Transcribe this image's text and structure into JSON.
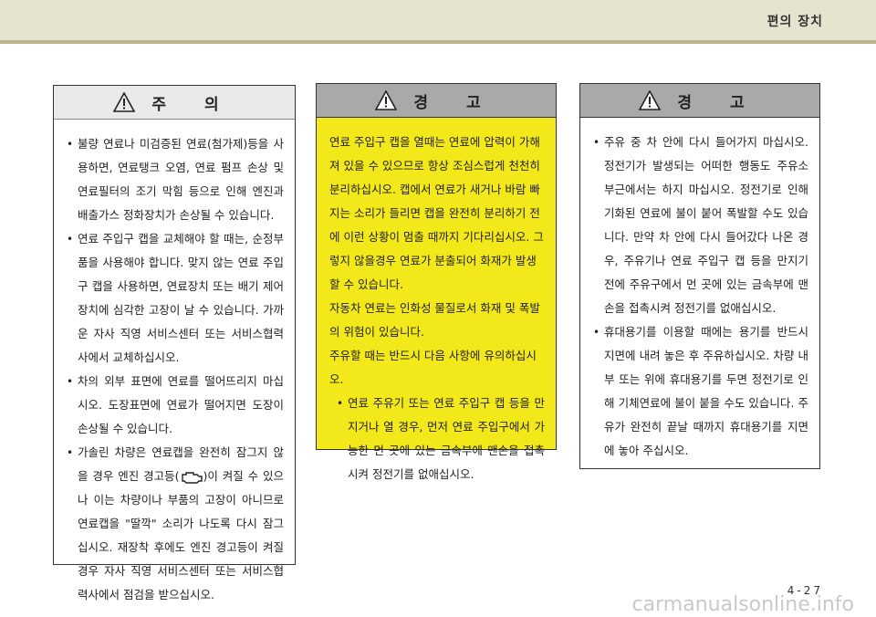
{
  "header": {
    "section_title": "편의 장치"
  },
  "caution": {
    "title": "주  의",
    "items": [
      "불량 연료나 미검증된 연료(첨가제)등을 사용하면, 연료탱크 오염, 연료 펌프 손상 및 연료필터의 조기 막힘 등으로 인해 엔진과 배출가스 정화장치가 손상될 수 있습니다.",
      "연료 주입구 캡을 교체해야 할 때는, 순정부품을 사용해야 합니다. 맞지 않는 연료 주입구 캡을 사용하면, 연료장치 또는 배기 제어장치에 심각한 고장이 날 수 있습니다. 가까운 자사 직영 서비스센터 또는 서비스협력사에서 교체하십시오.",
      "차의 외부 표면에 연료를 떨어뜨리지 마십시오. 도장표면에 연료가 떨어지면 도장이 손상될 수 있습니다.",
      {
        "before": "가솔린 차량은 연료캡을 완전히 잠그지 않을 경우 엔진 경고등(",
        "icon": "engine-check-icon",
        "after": ")이 켜질 수 있으나 이는 차량이나 부품의 고장이 아니므로 연료캡을 \"딸깍\" 소리가 나도록 다시 잠그십시오. 재장착 후에도 엔진 경고등이 켜질 경우 자사 직영 서비스센터 또는 서비스협력사에서 점검을 받으십시오."
      }
    ]
  },
  "warning1": {
    "title": "경  고",
    "paragraphs": [
      "연료 주입구 캡을 열때는 연료에 압력이 가해져 있을 수 있으므로 항상 조심스럽게 천천히 분리하십시오. 캡에서 연료가 새거나 바람 빠지는 소리가 들리면 캡을 완전히 분리하기 전에 이런 상황이 멈출 때까지 기다리십시오. 그렇지 않을경우 연료가 분출되어 화재가 발생할 수 있습니다.",
      "자동차 연료는 인화성 물질로서 화재 및 폭발의 위험이 있습니다.",
      "주유할 때는 반드시 다음 사항에 유의하십시오."
    ],
    "items": [
      "연료 주유기 또는 연료 주입구 캡 등을 만지거나 열 경우, 먼저 연료 주입구에서 가능한 먼 곳에 있는 금속부에 맨손을 접촉시켜 정전기를 없애십시오."
    ]
  },
  "warning2": {
    "title": "경  고",
    "items": [
      "주유 중 차 안에 다시 들어가지 마십시오. 정전기가 발생되는 어떠한 행동도 주유소 부근에서는 하지 마십시오. 정전기로 인해 기화된 연료에 불이 붙어 폭발할 수도 있습니다. 만약 차 안에 다시 들어갔다 나온 경우, 주유기나 연료 주입구 캡 등을 만지기 전에 주유구에서 먼 곳에 있는 금속부에 맨손을 접촉시켜 정전기를 없애십시오.",
      "휴대용기를 이용할 때에는 용기를 반드시 지면에 내려 놓은 후 주유하십시오. 차량 내부 또는 위에 휴대용기를 두면 정전기로 인해 기체연료에 불이 붙을 수도 있습니다. 주유가 완전히 끝날 때까지 휴대용기를 지면에 놓아 주십시오."
    ]
  },
  "footer": {
    "page_number": "4-27",
    "watermark": "carmanualsonline.info"
  }
}
